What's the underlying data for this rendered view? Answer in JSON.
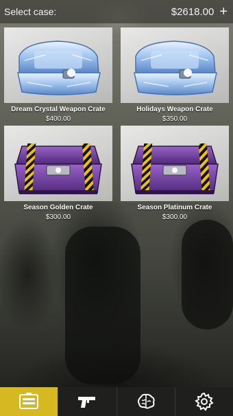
{
  "header": {
    "title": "Select case:",
    "balance": "$2618.00",
    "add_icon": "plus-icon"
  },
  "crates": [
    {
      "name": "Dream Crystal Weapon Crate",
      "price": "$400.00",
      "style": "crystal"
    },
    {
      "name": "Holidays Weapon Crate",
      "price": "$350.00",
      "style": "crystal"
    },
    {
      "name": "Season Golden Crate",
      "price": "$300.00",
      "style": "purple"
    },
    {
      "name": "Season Platinum Crate",
      "price": "$300.00",
      "style": "purple"
    }
  ],
  "navbar": {
    "items": [
      {
        "icon": "cases-icon",
        "active": true
      },
      {
        "icon": "gun-icon",
        "active": false
      },
      {
        "icon": "brain-icon",
        "active": false
      },
      {
        "icon": "settings-gear-icon",
        "active": false
      }
    ],
    "active_color": "#d6b921"
  }
}
